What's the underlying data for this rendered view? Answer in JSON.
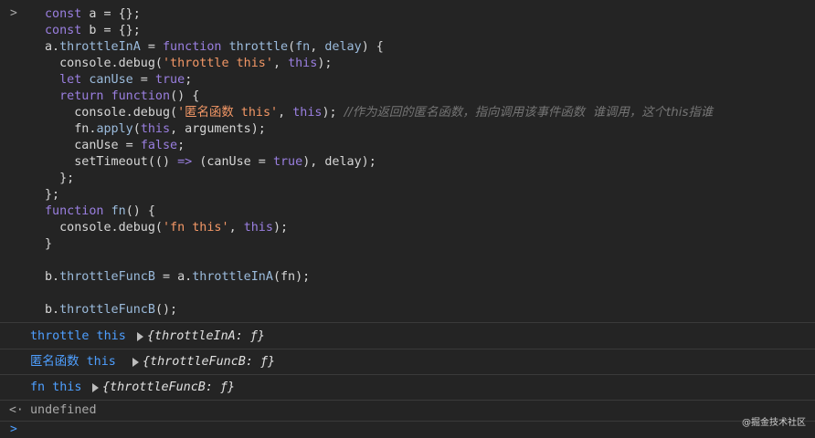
{
  "code": {
    "lines": [
      [
        {
          "t": "const ",
          "c": "kw"
        },
        {
          "t": "a = {};",
          "c": "plain"
        }
      ],
      [
        {
          "t": "const ",
          "c": "kw"
        },
        {
          "t": "b = {};",
          "c": "plain"
        }
      ],
      [
        {
          "t": "a.",
          "c": "plain"
        },
        {
          "t": "throttleInA",
          "c": "fnname"
        },
        {
          "t": " = ",
          "c": "plain"
        },
        {
          "t": "function ",
          "c": "kw"
        },
        {
          "t": "throttle",
          "c": "fnname"
        },
        {
          "t": "(",
          "c": "plain"
        },
        {
          "t": "fn",
          "c": "fnname"
        },
        {
          "t": ", ",
          "c": "plain"
        },
        {
          "t": "delay",
          "c": "fnname"
        },
        {
          "t": ") {",
          "c": "plain"
        }
      ],
      [
        {
          "t": "  console.debug(",
          "c": "plain"
        },
        {
          "t": "'throttle this'",
          "c": "str"
        },
        {
          "t": ", ",
          "c": "plain"
        },
        {
          "t": "this",
          "c": "kw"
        },
        {
          "t": ");",
          "c": "plain"
        }
      ],
      [
        {
          "t": "  ",
          "c": "plain"
        },
        {
          "t": "let ",
          "c": "kw"
        },
        {
          "t": "canUse",
          "c": "fnname"
        },
        {
          "t": " = ",
          "c": "plain"
        },
        {
          "t": "true",
          "c": "bool"
        },
        {
          "t": ";",
          "c": "plain"
        }
      ],
      [
        {
          "t": "  ",
          "c": "plain"
        },
        {
          "t": "return ",
          "c": "kw"
        },
        {
          "t": "function",
          "c": "kw"
        },
        {
          "t": "() {",
          "c": "plain"
        }
      ],
      [
        {
          "t": "    console.debug(",
          "c": "plain"
        },
        {
          "t": "'匿名函数 this'",
          "c": "str"
        },
        {
          "t": ", ",
          "c": "plain"
        },
        {
          "t": "this",
          "c": "kw"
        },
        {
          "t": "); ",
          "c": "plain"
        },
        {
          "t": "//作为返回的匿名函数，指向调用该事件函数  谁调用，这个this指谁",
          "c": "cmt-cjk"
        }
      ],
      [
        {
          "t": "    fn.",
          "c": "plain"
        },
        {
          "t": "apply",
          "c": "fnname"
        },
        {
          "t": "(",
          "c": "plain"
        },
        {
          "t": "this",
          "c": "kw"
        },
        {
          "t": ", arguments);",
          "c": "plain"
        }
      ],
      [
        {
          "t": "    canUse = ",
          "c": "plain"
        },
        {
          "t": "false",
          "c": "bool"
        },
        {
          "t": ";",
          "c": "plain"
        }
      ],
      [
        {
          "t": "    setTimeout(() ",
          "c": "plain"
        },
        {
          "t": "=>",
          "c": "kw"
        },
        {
          "t": " (canUse = ",
          "c": "plain"
        },
        {
          "t": "true",
          "c": "bool"
        },
        {
          "t": "), delay);",
          "c": "plain"
        }
      ],
      [
        {
          "t": "  };",
          "c": "plain"
        }
      ],
      [
        {
          "t": "};",
          "c": "plain"
        }
      ],
      [
        {
          "t": "function ",
          "c": "kw"
        },
        {
          "t": "fn",
          "c": "fnname"
        },
        {
          "t": "() {",
          "c": "plain"
        }
      ],
      [
        {
          "t": "  console.debug(",
          "c": "plain"
        },
        {
          "t": "'fn this'",
          "c": "str"
        },
        {
          "t": ", ",
          "c": "plain"
        },
        {
          "t": "this",
          "c": "kw"
        },
        {
          "t": ");",
          "c": "plain"
        }
      ],
      [
        {
          "t": "}",
          "c": "plain"
        }
      ],
      [
        {
          "t": "",
          "c": "plain"
        }
      ],
      [
        {
          "t": "b.",
          "c": "plain"
        },
        {
          "t": "throttleFuncB",
          "c": "fnname"
        },
        {
          "t": " = a.",
          "c": "plain"
        },
        {
          "t": "throttleInA",
          "c": "fnname"
        },
        {
          "t": "(fn);",
          "c": "plain"
        }
      ],
      [
        {
          "t": "",
          "c": "plain"
        }
      ],
      [
        {
          "t": "b.",
          "c": "plain"
        },
        {
          "t": "throttleFuncB",
          "c": "fnname"
        },
        {
          "t": "();",
          "c": "plain"
        }
      ]
    ]
  },
  "logs": [
    {
      "label": "throttle this",
      "preview": "{throttleInA: ƒ}"
    },
    {
      "label_cjk": "匿名函数",
      "label_rest": " this",
      "preview": "{throttleFuncB: ƒ}"
    },
    {
      "label": "fn this",
      "preview": "{throttleFuncB: ƒ}"
    }
  ],
  "result": {
    "arrow": "<·",
    "text": "undefined"
  },
  "prompt": {
    "chevron": ">"
  },
  "input_chevron": ">",
  "watermark": "@掘金技术社区",
  "colors": {
    "background": "#242424",
    "keyword": "#9a7fe0",
    "identifier": "#9bbbdc",
    "string": "#f29766",
    "comment": "#747474",
    "log_label": "#4e9fff"
  }
}
